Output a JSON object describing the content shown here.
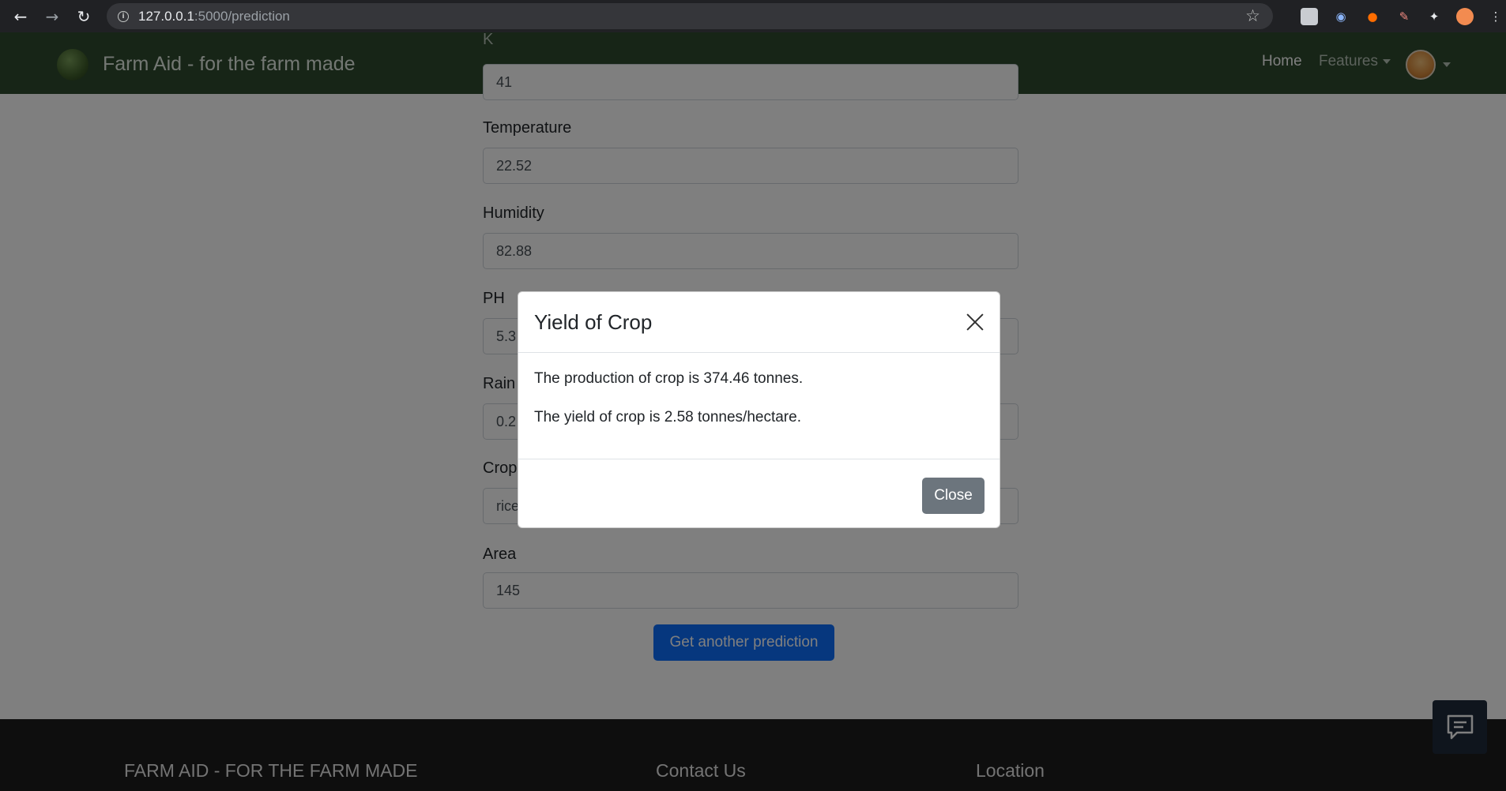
{
  "browser": {
    "url_host": "127.0.0.1",
    "url_path": ":5000/prediction"
  },
  "navbar": {
    "brand": "Farm Aid - for the farm made",
    "home": "Home",
    "features": "Features"
  },
  "form": {
    "k_label": "K",
    "k_value": "41",
    "temperature_label": "Temperature",
    "temperature_value": "22.52",
    "humidity_label": "Humidity",
    "humidity_value": "82.88",
    "ph_label": "PH",
    "ph_value": "5.3",
    "rainfall_label": "Rain",
    "rainfall_value": "0.2",
    "crop_label": "Crop",
    "crop_value": "rice",
    "area_label": "Area",
    "area_value": "145",
    "submit": "Get another prediction"
  },
  "footer": {
    "brand": "FARM AID - FOR THE FARM MADE",
    "contact": "Contact Us",
    "location": "Location"
  },
  "modal": {
    "title": "Yield of Crop",
    "production": "The production of crop is 374.46 tonnes.",
    "yield": "The yield of crop is 2.58 tonnes/hectare.",
    "close": "Close"
  }
}
